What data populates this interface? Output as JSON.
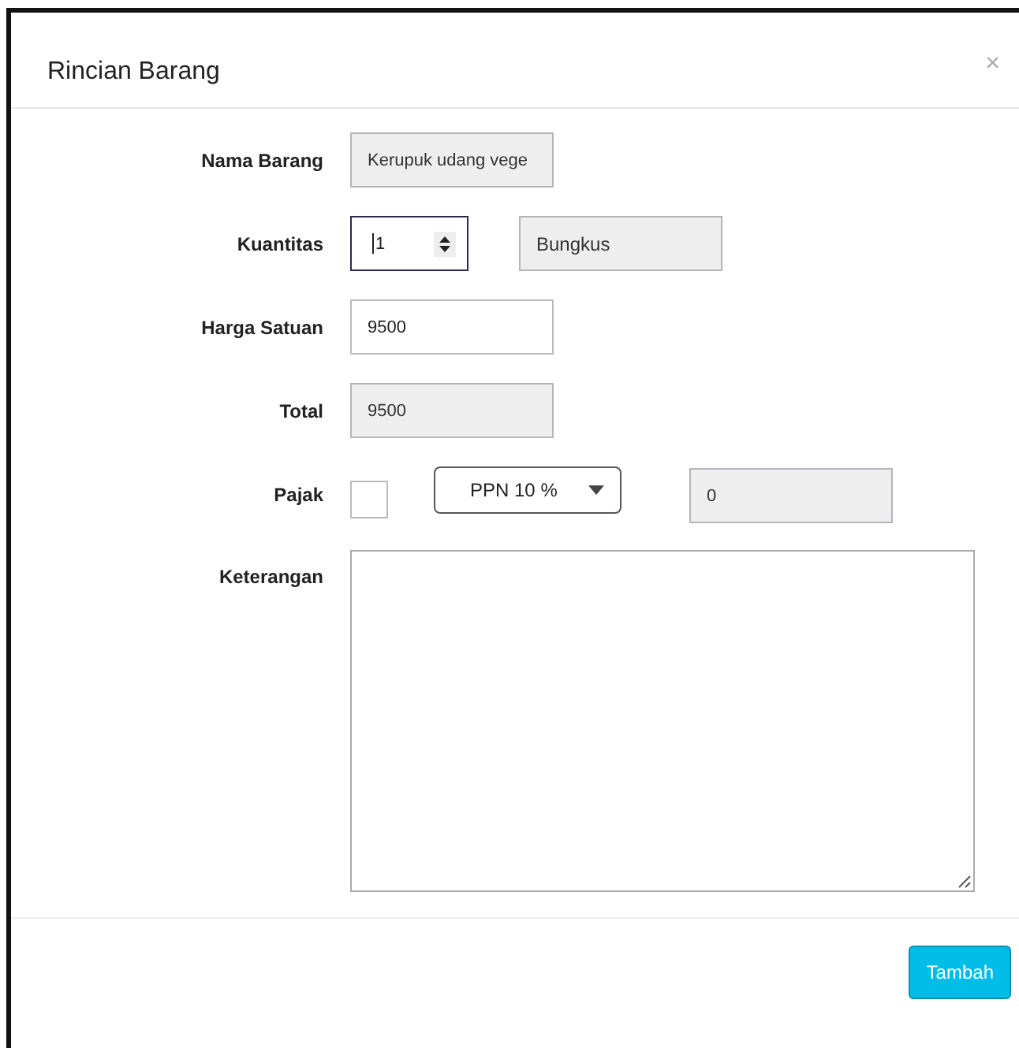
{
  "dialog": {
    "title": "Rincian Barang",
    "close": "×"
  },
  "fields": [
    {
      "kind": "text",
      "label": "Nama Barang",
      "value": "Kerupuk udang vege",
      "readonly": true
    },
    {
      "kind": "quantity",
      "label": "Kuantitas",
      "value": "1",
      "unit": "Bungkus"
    },
    {
      "kind": "text",
      "label": "Harga Satuan",
      "value": "9500",
      "readonly": false
    },
    {
      "kind": "text",
      "label": "Total",
      "value": "9500",
      "readonly": true
    },
    {
      "kind": "tax",
      "label": "Pajak",
      "checked": false,
      "option": "PPN 10 %",
      "value": "0"
    },
    {
      "kind": "textarea",
      "label": "Keterangan"
    }
  ],
  "buttons": [
    {
      "label": "Tambah"
    }
  ]
}
